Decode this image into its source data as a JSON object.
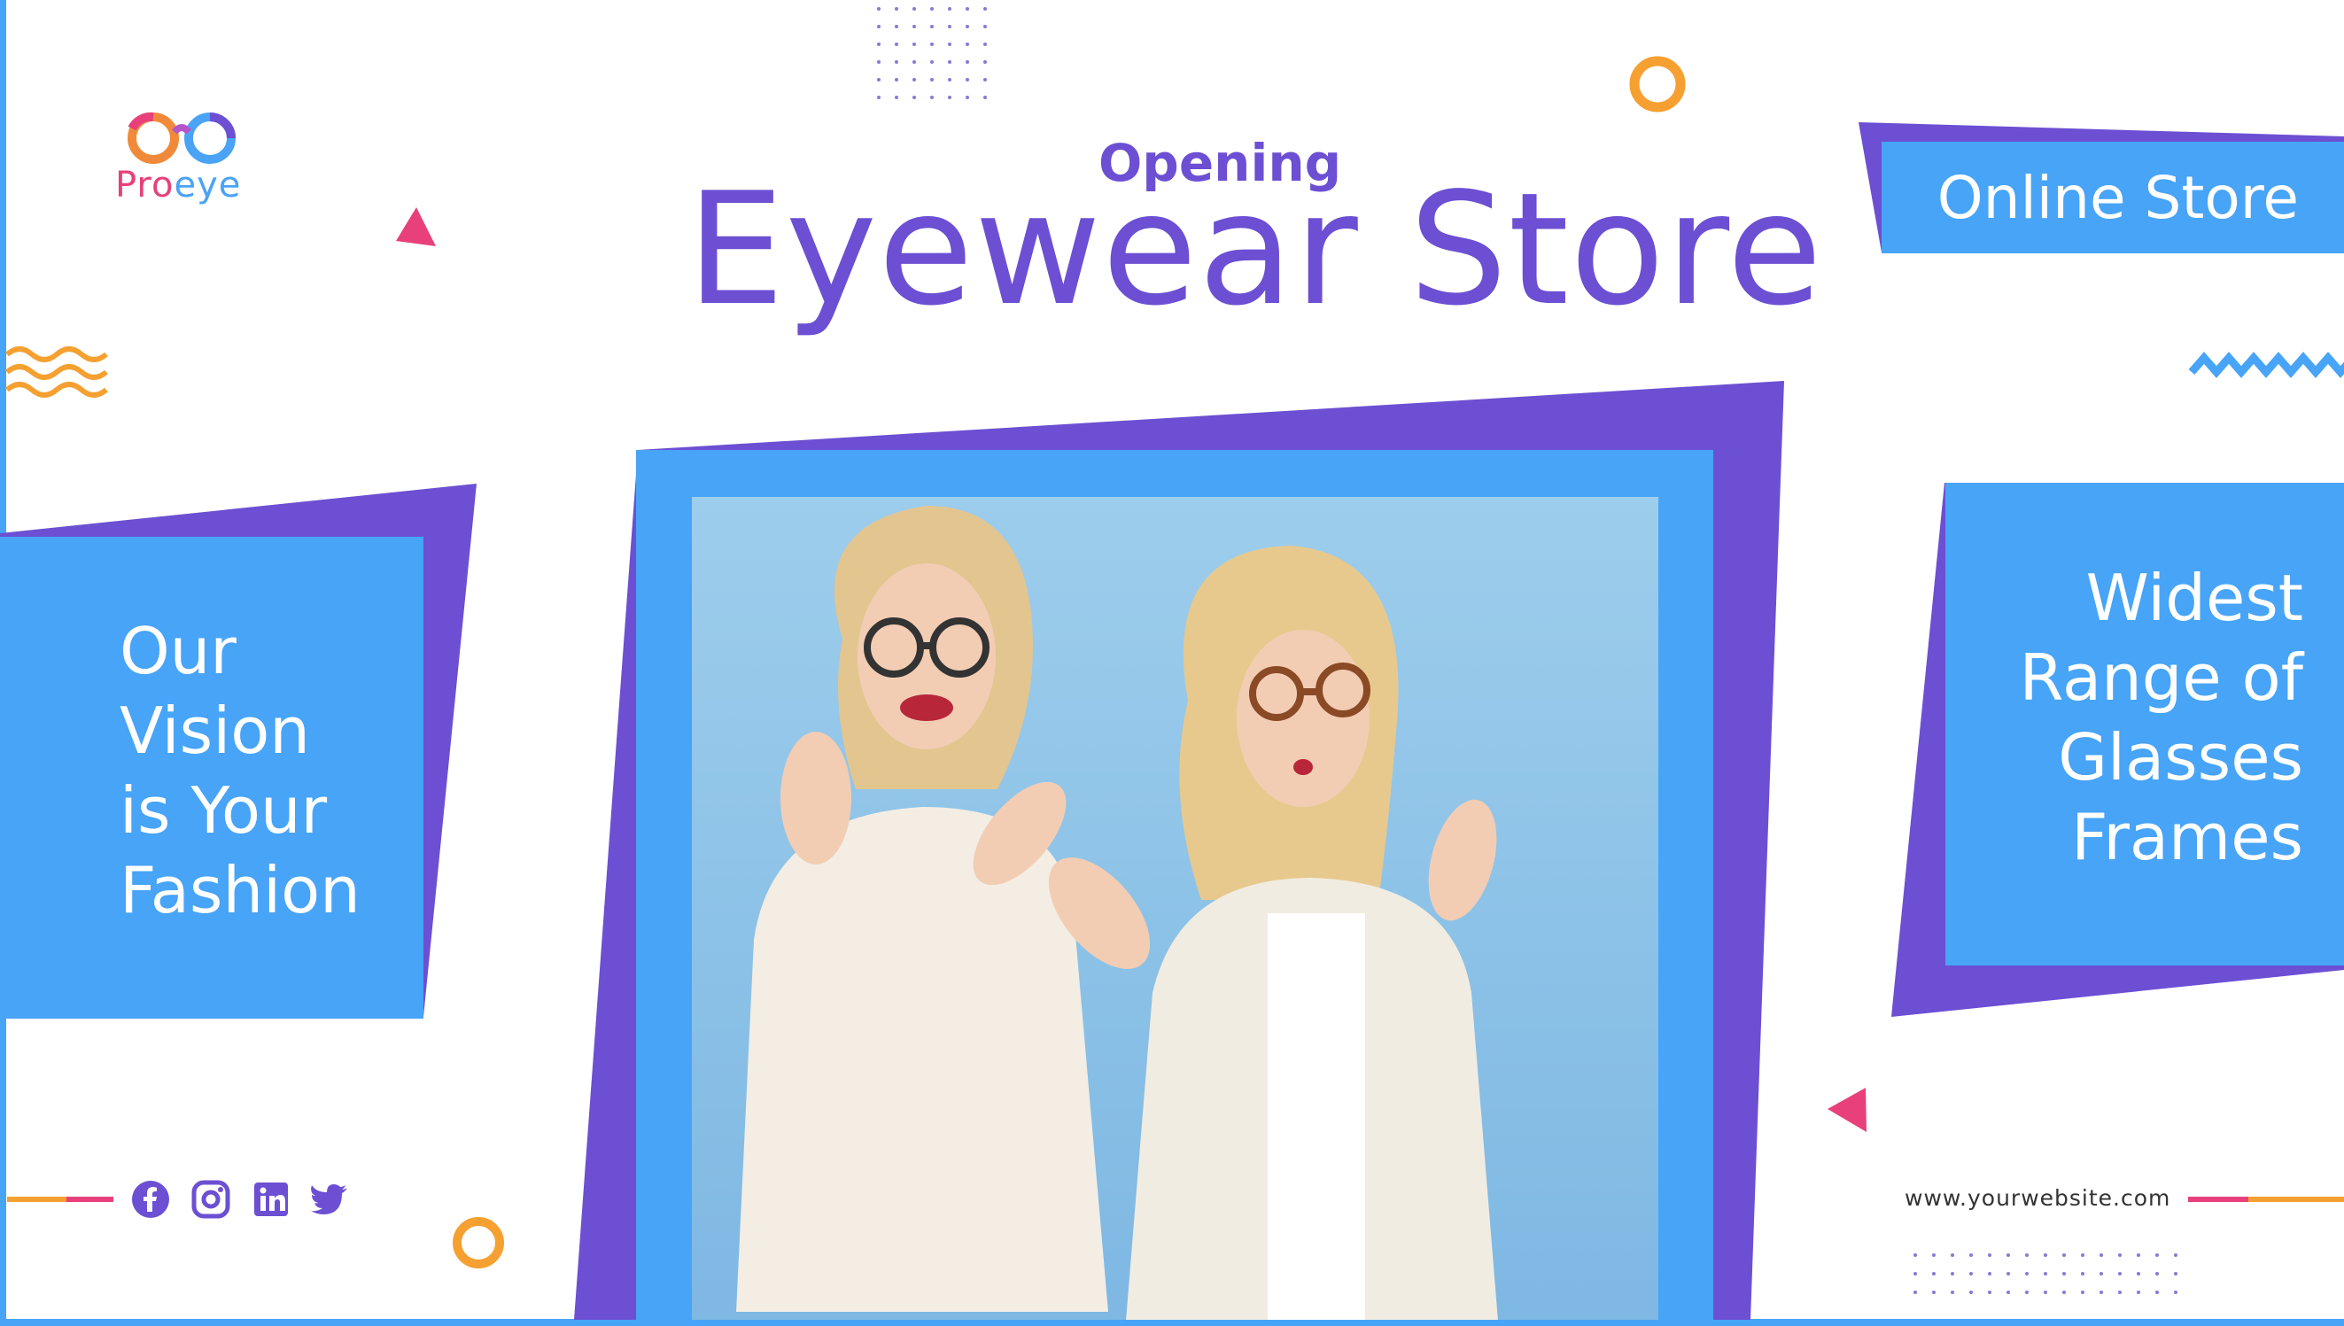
{
  "logo": {
    "part1": "Pro",
    "part2": "eye"
  },
  "header": {
    "eyebrow": "Opening",
    "title": "Eyewear Store"
  },
  "online_badge": {
    "label": "Online Store"
  },
  "left_panel": {
    "lines": [
      "Our",
      "Vision",
      "is Your",
      "Fashion"
    ]
  },
  "right_panel": {
    "lines": [
      "Widest",
      "Range of",
      "Glasses",
      "Frames"
    ]
  },
  "footer": {
    "website": "www.yourwebsite.com"
  },
  "social_icons": [
    "facebook-icon",
    "instagram-icon",
    "linkedin-icon",
    "twitter-icon"
  ],
  "colors": {
    "purple": "#6c4fd3",
    "blue": "#47a4f7",
    "pink": "#e8407a",
    "orange": "#f5a030",
    "photo_bg": "#a6d3ee"
  }
}
